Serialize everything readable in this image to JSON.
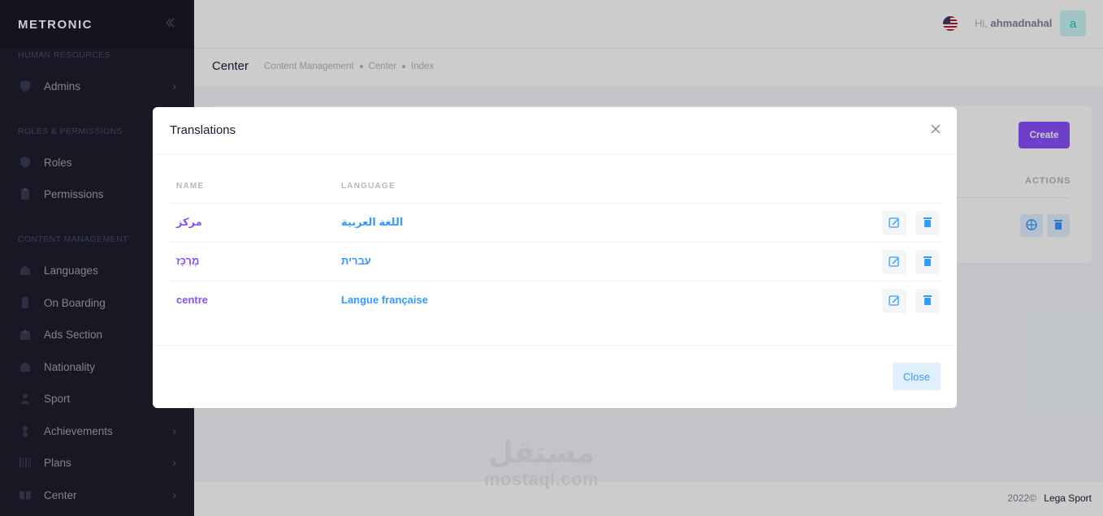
{
  "brand": {
    "logo": "METRONIC"
  },
  "sidebar": {
    "sections": [
      {
        "title": "HUMAN RESOURCES"
      },
      {
        "title": "ROLES & PERMISSIONS"
      },
      {
        "title": "CONTENT MANAGEMENT"
      }
    ],
    "items": [
      {
        "label": "Admins",
        "icon": "shield-icon",
        "has_arrow": true
      },
      {
        "label": "Roles",
        "icon": "shield-icon",
        "has_arrow": false
      },
      {
        "label": "Permissions",
        "icon": "clipboard-icon",
        "has_arrow": false
      },
      {
        "label": "Languages",
        "icon": "home-icon",
        "has_arrow": false
      },
      {
        "label": "On Boarding",
        "icon": "phone-icon",
        "has_arrow": false
      },
      {
        "label": "Ads Section",
        "icon": "upload-icon",
        "has_arrow": false
      },
      {
        "label": "Nationality",
        "icon": "home-icon",
        "has_arrow": false
      },
      {
        "label": "Sport",
        "icon": "person-icon",
        "has_arrow": false
      },
      {
        "label": "Achievements",
        "icon": "diamond-icon",
        "has_arrow": true
      },
      {
        "label": "Plans",
        "icon": "barcode-icon",
        "has_arrow": true
      },
      {
        "label": "Center",
        "icon": "book-icon",
        "has_arrow": true
      }
    ]
  },
  "header": {
    "greeting_prefix": "Hi,",
    "username": "ahmadnahal",
    "avatar_letter": "a",
    "flag": "us-flag-icon"
  },
  "subheader": {
    "title": "Center",
    "breadcrumbs": [
      "Content Management",
      "Center",
      "Index"
    ]
  },
  "card": {
    "create_label": "Create",
    "actions_label": "ACTIONS"
  },
  "modal": {
    "title": "Translations",
    "columns": {
      "name": "NAME",
      "language": "LANGUAGE"
    },
    "rows": [
      {
        "name": "مركز",
        "language": "اللغة العربية"
      },
      {
        "name": "מֶרְכָּז",
        "language": "עברית"
      },
      {
        "name": "centre",
        "language": "Langue française"
      }
    ],
    "close_label": "Close"
  },
  "footer": {
    "year": "2022©",
    "company": "Lega Sport"
  },
  "watermark": {
    "arabic": "مستقل",
    "latin": "mostaql.com"
  },
  "colors": {
    "sidebar_bg": "#1e1e2d",
    "primary": "#8950fc",
    "info": "#3699ff",
    "overlay": "rgba(0,0,0,0.2)"
  }
}
